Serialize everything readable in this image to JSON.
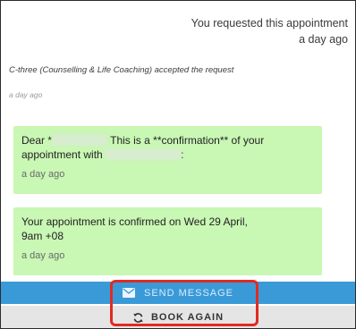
{
  "thread": {
    "requested_text": "You requested this appointment",
    "requested_time": "a day ago",
    "accepted_text": "C-three (Counselling & Life Coaching) accepted the request",
    "accepted_time": "a day ago",
    "messages": [
      {
        "line1_a": "Dear *",
        "line1_b": " This is a **confirmation** of your",
        "line2": "appointment with",
        "line2_end": ":",
        "time": "a day ago"
      },
      {
        "line1": "Your appointment is confirmed on Wed 29 April,",
        "line2": "9am +08",
        "time": "a day ago"
      }
    ]
  },
  "toolbar": {
    "send_label": "SEND MESSAGE",
    "book_label": "BOOK AGAIN"
  },
  "colors": {
    "bubble": "#c9f7b4",
    "send_button": "#3a9ad8",
    "book_button": "#e5e5e5",
    "highlight": "#e12a22"
  },
  "icons": {
    "send": "envelope-icon",
    "book": "refresh-icon"
  }
}
